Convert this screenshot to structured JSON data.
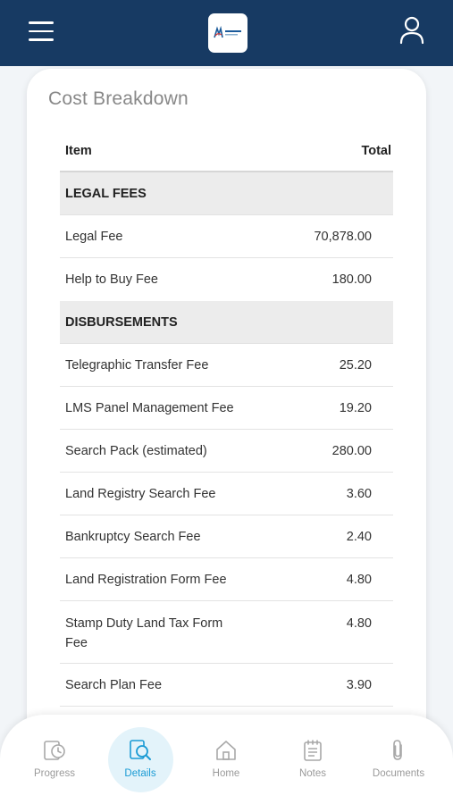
{
  "header": {
    "menu_icon": "hamburger-menu-icon",
    "logo_icon": "company-logo",
    "user_icon": "user-profile-icon"
  },
  "card": {
    "title": "Cost Breakdown",
    "columns": {
      "item": "Item",
      "total": "Total"
    },
    "sections": [
      {
        "label": "LEGAL FEES",
        "rows": [
          {
            "item": "Legal Fee",
            "total": "70,878.00"
          },
          {
            "item": "Help to Buy Fee",
            "total": "180.00"
          }
        ]
      },
      {
        "label": "DISBURSEMENTS",
        "rows": [
          {
            "item": "Telegraphic Transfer Fee",
            "total": "25.20"
          },
          {
            "item": "LMS Panel Management Fee",
            "total": "19.20"
          },
          {
            "item": "Search Pack (estimated)",
            "total": "280.00"
          },
          {
            "item": "Land Registry Search Fee",
            "total": "3.60"
          },
          {
            "item": "Bankruptcy Search Fee",
            "total": "2.40"
          },
          {
            "item": "Land Registration Form Fee",
            "total": "4.80"
          },
          {
            "item": "Stamp Duty Land Tax Form Fee",
            "total": "4.80"
          },
          {
            "item": "Search Plan Fee",
            "total": "3.90"
          }
        ]
      }
    ]
  },
  "nav": {
    "items": [
      {
        "label": "Progress",
        "icon": "progress-icon"
      },
      {
        "label": "Details",
        "icon": "details-search-icon",
        "active": true
      },
      {
        "label": "Home",
        "icon": "home-icon"
      },
      {
        "label": "Notes",
        "icon": "notes-icon"
      },
      {
        "label": "Documents",
        "icon": "paperclip-icon"
      }
    ]
  },
  "colors": {
    "header_bg": "#173a63",
    "accent": "#1a9bd4",
    "active_bg": "#e3f3fa"
  }
}
